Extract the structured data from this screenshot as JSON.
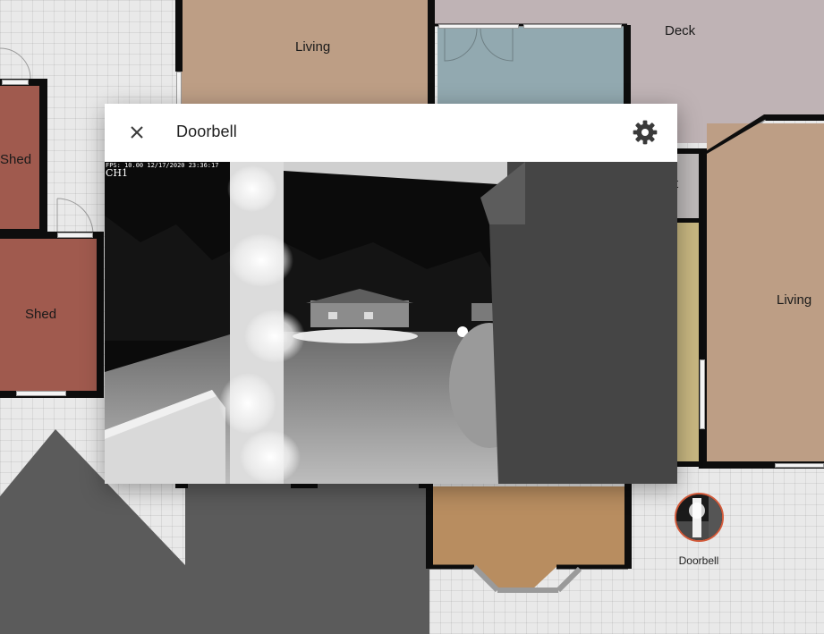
{
  "floorplan": {
    "rooms": [
      {
        "id": "living-top",
        "label": "Living"
      },
      {
        "id": "deck",
        "label": "Deck"
      },
      {
        "id": "shed-top",
        "label": "Shed"
      },
      {
        "id": "shed-bottom",
        "label": "Shed"
      },
      {
        "id": "living-right",
        "label": "Living"
      },
      {
        "id": "hidden-t",
        "label": "t"
      }
    ],
    "colors": {
      "living": "#bd9e85",
      "deck": "#bfb3b5",
      "shed": "#a05a4e",
      "glass": "#92a9b0",
      "porch": "#b88d60",
      "closet": "#c8b781",
      "road": "#5a5a5a"
    }
  },
  "dialog": {
    "title": "Doorbell",
    "close_icon": "close-icon",
    "settings_icon": "gear-icon",
    "camera": {
      "osd_line": "FPS: 10.00 12/17/2020 23:36:17",
      "channel": "CH1"
    }
  },
  "badge": {
    "label": "Doorbell",
    "border_color": "#d35a3a"
  }
}
